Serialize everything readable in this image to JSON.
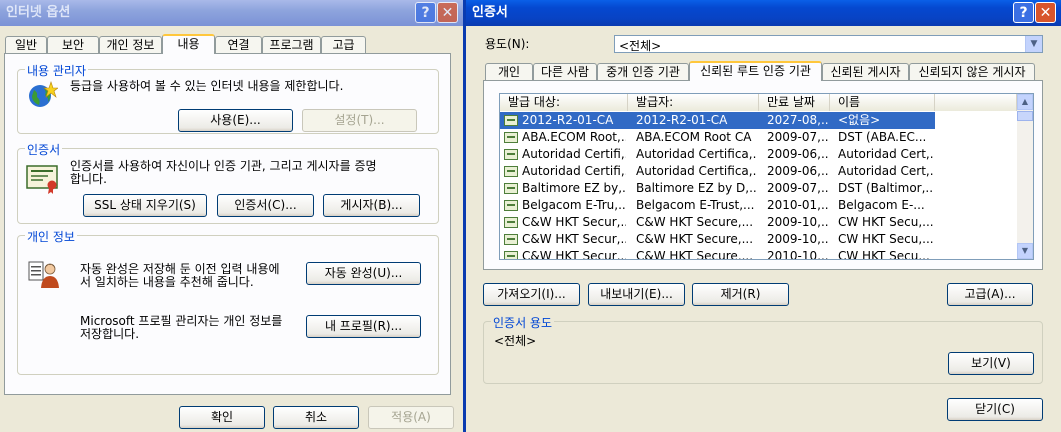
{
  "left_dialog": {
    "title": "인터넷 옵션",
    "tabs": [
      "일반",
      "보안",
      "개인 정보",
      "내용",
      "연결",
      "프로그램",
      "고급"
    ],
    "content_advisor": {
      "title": "내용 관리자",
      "desc": "등급을 사용하여 볼 수 있는 인터넷 내용을 제한합니다.",
      "enable_btn": "사용(E)...",
      "settings_btn": "설정(T)..."
    },
    "certificates": {
      "title": "인증서",
      "desc1": "인증서를 사용하여 자신이나 인증 기관, 그리고 게시자를 증명",
      "desc2": "합니다.",
      "ssl_btn": "SSL 상태 지우기(S)",
      "certs_btn": "인증서(C)...",
      "publishers_btn": "게시자(B)..."
    },
    "personal": {
      "title": "개인 정보",
      "autocomplete_desc1": "자동 완성은 저장해 둔 이전 입력 내용에",
      "autocomplete_desc2": "서 일치하는 내용을 추천해 줍니다.",
      "autocomplete_btn": "자동 완성(U)...",
      "profile_desc1": "Microsoft 프로필 관리자는 개인 정보를",
      "profile_desc2": "저장합니다.",
      "profile_btn": "내 프로필(R)..."
    },
    "ok_btn": "확인",
    "cancel_btn": "취소",
    "apply_btn": "적용(A)"
  },
  "right_dialog": {
    "title": "인증서",
    "purpose_label": "용도(N):",
    "purpose_value": "<전체>",
    "tabs": [
      "개인",
      "다른 사람",
      "중개 인증 기관",
      "신뢰된 루트 인증 기관",
      "신뢰된 게시자",
      "신뢰되지 않은 게시자"
    ],
    "columns": [
      "발급 대상:",
      "발급자:",
      "만료 날짜",
      "이름"
    ],
    "rows": [
      [
        "2012-R2-01-CA",
        "2012-R2-01-CA",
        "2027-08,...",
        "<없음>"
      ],
      [
        "ABA.ECOM Root,...",
        "ABA.ECOM Root CA",
        "2009-07,...",
        "DST (ABA.EC..."
      ],
      [
        "Autoridad Certifi,...",
        "Autoridad Certifica,...",
        "2009-06,...",
        "Autoridad Cert,..."
      ],
      [
        "Autoridad Certifi,...",
        "Autoridad Certifica,...",
        "2009-06,...",
        "Autoridad Cert,..."
      ],
      [
        "Baltimore EZ by,...",
        "Baltimore EZ by D,...",
        "2009-07,...",
        "DST (Baltimor,..."
      ],
      [
        "Belgacom E-Tru,...",
        "Belgacom E-Trust,...",
        "2010-01,...",
        "Belgacom E-..."
      ],
      [
        "C&W HKT Secur,...",
        "C&W HKT Secure,...",
        "2009-10,...",
        "CW HKT Secu,..."
      ],
      [
        "C&W HKT Secur,...",
        "C&W HKT Secure,...",
        "2009-10,...",
        "CW HKT Secu,..."
      ],
      [
        "C&W HKT Secur,...",
        "C&W HKT Secure,...",
        "2010-10,...",
        "CW HKT Secu..."
      ]
    ],
    "import_btn": "가져오기(I)...",
    "export_btn": "내보내기(E)...",
    "remove_btn": "제거(R)",
    "advanced_btn": "고급(A)...",
    "purposes_title": "인증서 용도",
    "purposes_value": "<전체>",
    "view_btn": "보기(V)",
    "close_btn": "닫기(C)"
  }
}
